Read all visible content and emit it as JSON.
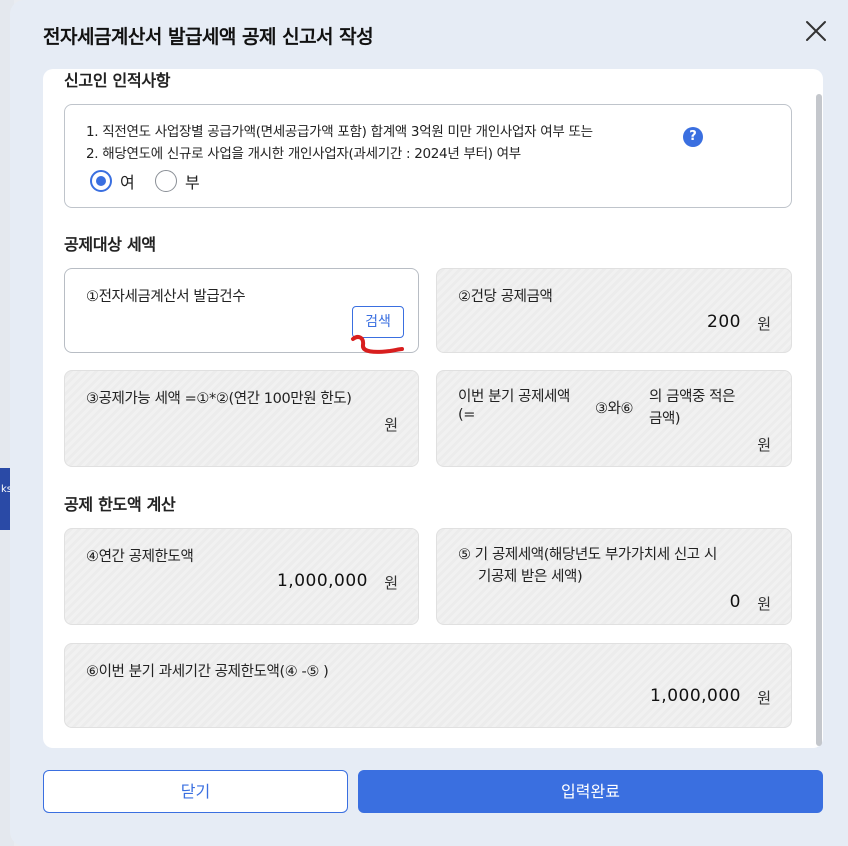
{
  "modal": {
    "title": "전자세금계산서 발급세액 공제 신고서 작성"
  },
  "section_reporter": {
    "title": "신고인 인적사항",
    "line1": "1. 직전연도 사업장별 공급가액(면세공급가액 포함)  합계액 3억원 미만 개인사업자 여부 또는",
    "line2": "2. 해당연도에 신규로 사업을 개시한 개인사업자(과세기간 : 2024년 부터) 여부",
    "help": "?",
    "options": [
      {
        "label": "여",
        "checked": true
      },
      {
        "label": "부",
        "checked": false
      }
    ]
  },
  "section_target": {
    "title": "공제대상 세액",
    "card1": {
      "label": "①전자세금계산서 발급건수",
      "button": "검색"
    },
    "card2": {
      "label": "②건당 공제금액",
      "value": "200",
      "unit": "원"
    },
    "card3": {
      "label": "③공제가능 세액 =①*②(연간 100만원 한도)",
      "value": "",
      "unit": "원"
    },
    "card4": {
      "label_a": "이번 분기 공제세액",
      "label_b": "(=",
      "label_c": "③와⑥",
      "label_d": "의 금액중 적은",
      "label_e": "금액)",
      "value": "",
      "unit": "원"
    }
  },
  "section_limit": {
    "title": "공제 한도액 계산",
    "card5": {
      "label": "④연간 공제한도액",
      "value": "1,000,000",
      "unit": "원"
    },
    "card6": {
      "label_a": "⑤ 기 공제세액(해당년도 부가가치세 신고 시",
      "label_b": "기공제 받은 세액)",
      "value": "0",
      "unit": "원"
    },
    "card7": {
      "label": "⑥이번 분기 과세기간 공제한도액(④ -⑤ )",
      "value": "1,000,000",
      "unit": "원"
    }
  },
  "footer": {
    "close_label": "닫기",
    "submit_label": "입력완료"
  },
  "backdrop": {
    "tab_text": "ks"
  },
  "colors": {
    "accent": "#3a6fe0",
    "annotation": "#d81e1e"
  }
}
